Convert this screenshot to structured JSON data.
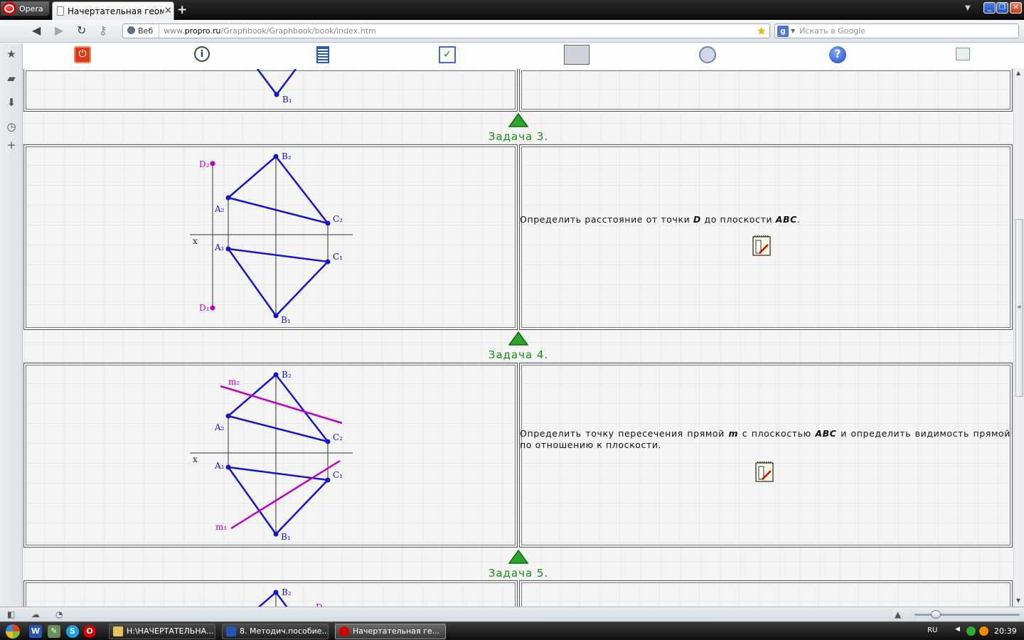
{
  "browser": {
    "menu_label": "Opera",
    "tab_title": "Начертательная геоме...",
    "tab_close": "✕",
    "new_tab": "+",
    "address_mode": "Веб",
    "url_prefix": "www.",
    "url_domain": "propro.ru",
    "url_path": "/Graphbook/Graphbook/book/index.htm",
    "search_placeholder": "Искать в Google"
  },
  "tasks": [
    {
      "title": "Задача 3.",
      "desc_before": "Определить расстояние от точки ",
      "desc_b1": "D",
      "desc_mid": " до плоскости ",
      "desc_b2": "ABC",
      "desc_after": "."
    },
    {
      "title": "Задача 4.",
      "desc_before": "Определить точку пересечения прямой ",
      "desc_b1": "m",
      "desc_mid": " с плоскостью ",
      "desc_b2": "ABC",
      "desc_after": " и определить видимость прямой по отношению к плоскости."
    },
    {
      "title": "Задача 5."
    }
  ],
  "labels": {
    "B1": "B₁",
    "B2": "B₂",
    "A1": "A₁",
    "A2": "A₂",
    "C1": "C₁",
    "C2": "C₂",
    "D1": "D₁",
    "D2": "D₂",
    "m1": "m₁",
    "m2": "m₂",
    "x": "x",
    "D": "D"
  },
  "colors": {
    "blue_line": "#1414c8",
    "magenta": "#c000c0",
    "task_title": "#138b13"
  },
  "taskbar": {
    "items": [
      "H:\\НАЧЕРТАТЕЛЬНА...",
      "8. Методич.пособие...",
      "Начертательная ге..."
    ],
    "lang": "RU",
    "time": "20:39"
  }
}
